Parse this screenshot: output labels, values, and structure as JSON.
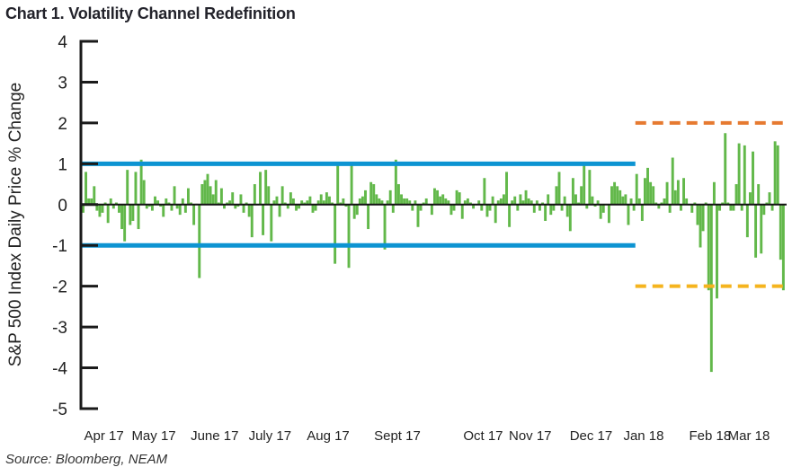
{
  "title": "Chart 1. Volatility Channel Redefinition",
  "source": "Source: Bloomberg, NEAM",
  "colors": {
    "bars": "#62b84a",
    "old_channel": "#0d94d2",
    "new_upper": "#e67a31",
    "new_lower": "#f5b41e",
    "axis": "#1a1a1a"
  },
  "chart_data": {
    "type": "bar",
    "title": "Chart 1. Volatility Channel Redefinition",
    "xlabel": "",
    "ylabel": "S&P 500 Index Daily Price % Change",
    "ylim": [
      -5,
      4
    ],
    "yticks": [
      4,
      3,
      2,
      1,
      0,
      -1,
      -2,
      -3,
      -4,
      -5
    ],
    "xtick_labels": [
      "Apr 17",
      "May 17",
      "June 17",
      "July 17",
      "Aug 17",
      "Sept 17",
      "Oct 17",
      "Nov 17",
      "Dec 17",
      "Jan 18",
      "Feb 18",
      "Mar 18"
    ],
    "xtick_positions": [
      8,
      26,
      48,
      68,
      89,
      114,
      145,
      162,
      184,
      203,
      227,
      241
    ],
    "n_days": 254,
    "grid": false,
    "legend": "none",
    "reference_lines": [
      {
        "name": "old-channel-upper",
        "value": 1.0,
        "from_day": 0,
        "to_day": 199,
        "style": "solid",
        "color_key": "old_channel"
      },
      {
        "name": "old-channel-lower",
        "value": -1.0,
        "from_day": 0,
        "to_day": 199,
        "style": "solid",
        "color_key": "old_channel"
      },
      {
        "name": "new-channel-upper",
        "value": 2.0,
        "from_day": 200,
        "to_day": 253,
        "style": "dashed",
        "color_key": "new_upper"
      },
      {
        "name": "new-channel-lower",
        "value": -2.0,
        "from_day": 200,
        "to_day": 253,
        "style": "dashed",
        "color_key": "new_lower"
      }
    ],
    "series": [
      {
        "name": "S&P 500 Daily % Change",
        "values": [
          -0.2,
          0.8,
          0.15,
          0.15,
          0.45,
          -0.15,
          -0.3,
          -0.2,
          0.05,
          -0.45,
          0.15,
          -0.1,
          0.05,
          -0.2,
          -0.6,
          -0.9,
          0.85,
          -0.5,
          -0.4,
          0.8,
          -0.6,
          1.1,
          0.6,
          -0.1,
          -0.05,
          -0.15,
          0.2,
          0.1,
          -0.05,
          -0.3,
          0.15,
          0.05,
          -0.15,
          0.45,
          -0.1,
          -0.25,
          0.15,
          -0.2,
          0.4,
          0.05,
          -0.5,
          0.02,
          -1.8,
          0.5,
          0.6,
          0.75,
          0.45,
          0.25,
          0.6,
          0.05,
          0.4,
          -0.1,
          0.05,
          0.1,
          0.3,
          -0.1,
          -0.05,
          0.25,
          -0.2,
          0.05,
          -0.3,
          -0.8,
          0.5,
          0.0,
          0.8,
          -0.75,
          0.85,
          0.45,
          -0.9,
          0.1,
          0.2,
          -0.3,
          0.45,
          0.05,
          -0.1,
          0.3,
          0.15,
          -0.15,
          -0.1,
          0.1,
          0.05,
          0.1,
          0.2,
          -0.2,
          -0.15,
          0.1,
          0.25,
          0.1,
          0.3,
          0.2,
          0.05,
          -1.45,
          1.0,
          0.05,
          0.15,
          -0.05,
          -1.55,
          1.0,
          -0.35,
          -0.25,
          0.15,
          0.2,
          0.35,
          -0.6,
          0.55,
          0.5,
          0.25,
          0.15,
          0.1,
          -1.1,
          0.1,
          0.35,
          -0.2,
          1.1,
          0.5,
          0.25,
          0.15,
          0.15,
          0.1,
          -0.15,
          0.1,
          -0.55,
          -0.15,
          0.05,
          0.15,
          0.0,
          -0.25,
          0.4,
          0.35,
          0.2,
          0.25,
          0.15,
          0.1,
          -0.25,
          -0.15,
          0.35,
          0.3,
          -0.35,
          0.1,
          0.15,
          0.05,
          -0.1,
          0.0,
          0.1,
          -0.15,
          0.65,
          -0.3,
          -0.15,
          0.2,
          -0.45,
          0.1,
          0.15,
          0.25,
          0.8,
          -0.55,
          0.1,
          0.2,
          -0.15,
          0.25,
          0.1,
          0.35,
          0.15,
          0.1,
          -0.2,
          0.1,
          -0.15,
          0.05,
          -0.4,
          0.25,
          -0.25,
          -0.15,
          0.45,
          0.8,
          -0.15,
          0.2,
          -0.3,
          -0.65,
          0.65,
          0.25,
          0.05,
          0.45,
          1.0,
          -0.1,
          0.85,
          0.2,
          -0.05,
          0.1,
          -0.35,
          -0.2,
          0.0,
          -0.45,
          0.45,
          0.55,
          0.45,
          0.35,
          0.2,
          0.25,
          -0.5,
          0.15,
          -0.15,
          0.75,
          0.15,
          -0.4,
          0.65,
          0.9,
          0.55,
          0.45,
          0.05,
          -0.1,
          0.05,
          0.15,
          0.55,
          -0.2,
          1.15,
          0.35,
          0.6,
          -0.15,
          0.65,
          0.15,
          0.0,
          -0.2,
          0.05,
          -0.5,
          -1.05,
          -0.65,
          0.05,
          -2.1,
          -4.1,
          0.55,
          -2.3,
          -0.15,
          0.05,
          1.75,
          0.05,
          -0.15,
          -0.15,
          0.5,
          1.5,
          -0.15,
          1.45,
          -0.8,
          0.3,
          1.3,
          -1.3,
          0.5,
          -1.2,
          -0.25,
          0.05,
          0.3,
          -0.15,
          1.55,
          1.45,
          -1.35,
          -2.1
        ]
      }
    ]
  }
}
